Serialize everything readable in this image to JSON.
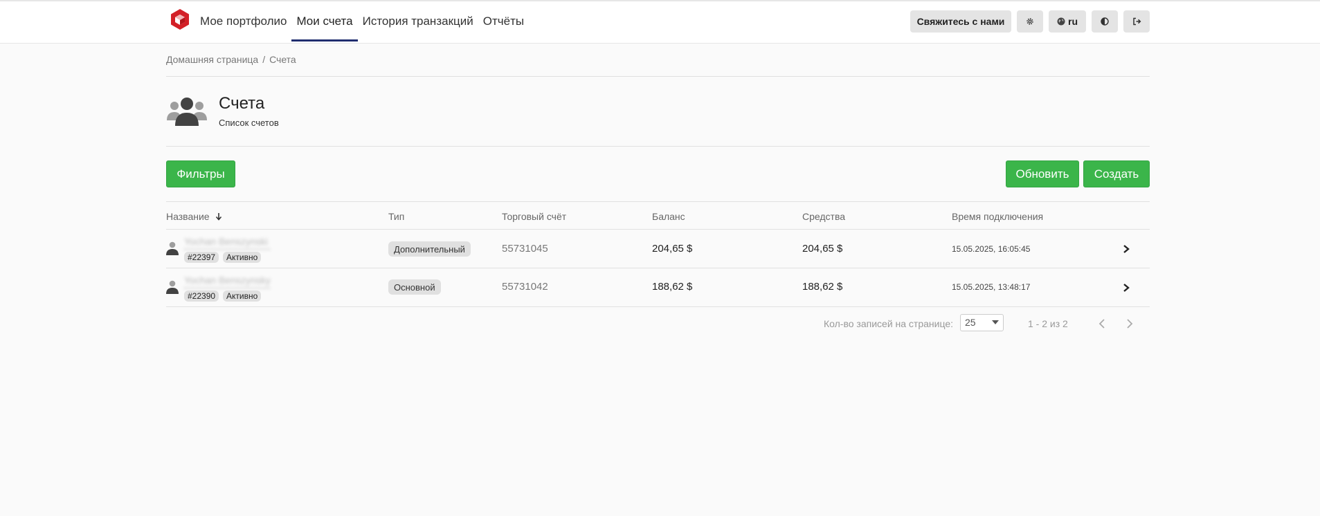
{
  "nav": {
    "links": [
      {
        "label": "Мое портфолио"
      },
      {
        "label": "Мои счета"
      },
      {
        "label": "История транзакций"
      },
      {
        "label": "Отчёты"
      }
    ],
    "contact_label": "Свяжитесь с нами",
    "lang_label": "ru",
    "active_index": 1
  },
  "breadcrumb": {
    "home": "Домашняя страница",
    "separator": "/",
    "current": "Счета"
  },
  "page": {
    "title": "Счета",
    "subtitle": "Список счетов"
  },
  "toolbar": {
    "filters_label": "Фильтры",
    "refresh_label": "Обновить",
    "create_label": "Создать"
  },
  "table": {
    "headers": {
      "name": "Название",
      "type": "Тип",
      "account": "Торговый счёт",
      "balance": "Баланс",
      "funds": "Средства",
      "connected": "Время подключения"
    },
    "sort_icon": "arrow-down-icon",
    "rows": [
      {
        "name": "Yochan Benszynski",
        "id": "#22397",
        "status": "Активно",
        "type": "Дополнительный",
        "account": "55731045",
        "balance": "204,65 $",
        "funds": "204,65 $",
        "connected": "15.05.2025, 16:05:45"
      },
      {
        "name": "Yochan Benszynsky",
        "id": "#22390",
        "status": "Активно",
        "type": "Основной",
        "account": "55731042",
        "balance": "188,62 $",
        "funds": "188,62 $",
        "connected": "15.05.2025, 13:48:17"
      }
    ]
  },
  "pagination": {
    "per_page_label": "Кол-во записей на странице:",
    "per_page_value": "25",
    "info": "1 - 2 из 2"
  },
  "colors": {
    "accent_green": "#3bb54a",
    "nav_active": "#1f2d6e",
    "logo_red": "#d32027"
  }
}
